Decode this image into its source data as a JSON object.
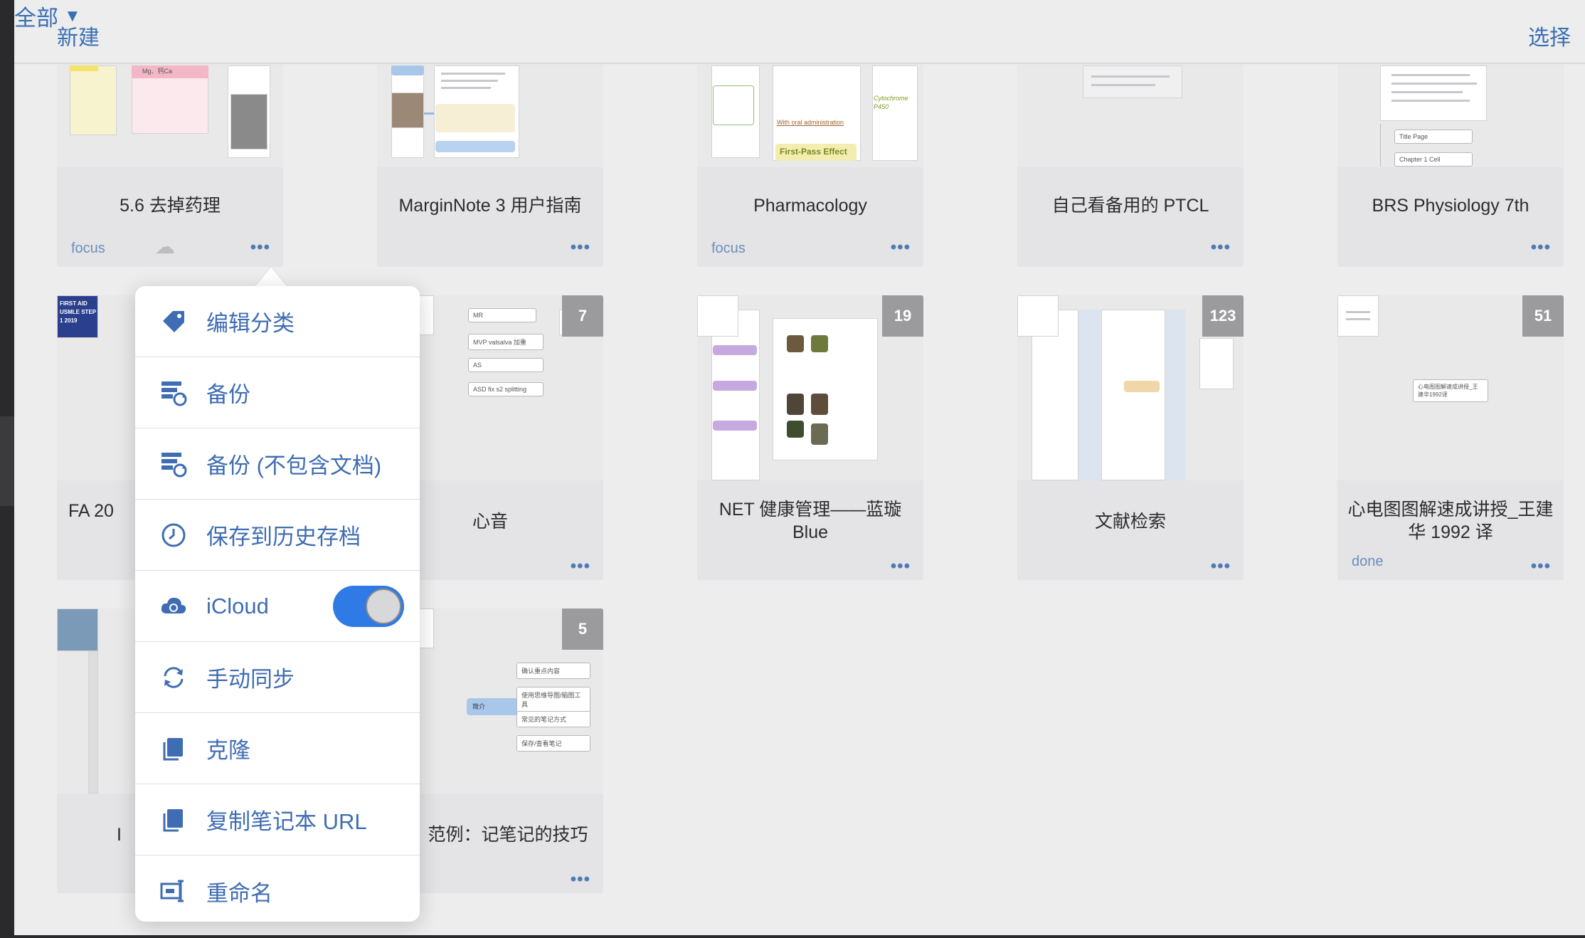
{
  "header": {
    "new_label": "新建",
    "filter_label": "全部",
    "filter_caret": "▼",
    "select_label": "选择"
  },
  "notebooks": [
    {
      "title": "5.6 去掉药理",
      "tag": "focus",
      "more": "•••",
      "cloud": true
    },
    {
      "title": "MarginNote 3 用户指南",
      "more": "•••"
    },
    {
      "title": "Pharmacology",
      "tag": "focus",
      "more": "•••"
    },
    {
      "title": "自己看备用的 PTCL",
      "more": "•••"
    },
    {
      "title": "BRS Physiology 7th",
      "more": "•••"
    },
    {
      "title": "FA 20",
      "more": "•••"
    },
    {
      "title": "心音",
      "badge": "7",
      "more": "•••"
    },
    {
      "title": "NET 健康管理——蓝璇 Blue",
      "badge": "19",
      "more": "•••"
    },
    {
      "title": "文献检索",
      "badge": "123",
      "more": "•••"
    },
    {
      "title": "心电图图解速成讲授_王建华 1992 译",
      "badge": "51",
      "tag": "done",
      "more": "•••"
    },
    {
      "title": "I",
      "more": "•••"
    },
    {
      "title": "范例：记笔记的技巧",
      "badge": "5",
      "more": "•••"
    }
  ],
  "thumb_text": {
    "first_pass": "First-Pass Effect",
    "oral_admin": "With oral administration",
    "cytochrome": "Cytochrome P450",
    "title_page": "Title Page",
    "chapter1": "Chapter 1 Cell",
    "mvp": "MVP valsalva 加重",
    "as": "AS",
    "asd": "ASD fix s2 splitting",
    "mr": "MR",
    "ecg_node": "心电图图解速成讲授_王建华1992译",
    "jianjie": "简介",
    "note1": "确认重点内容",
    "note2": "使用思维导图/脑图工具",
    "note3": "常见的笔记方式",
    "note4": "保存/查看笔记",
    "fa_cover": "FIRST AID USMLE STEP 1 2019",
    "mg_ca": "Mg、钙Ca"
  },
  "menu": {
    "items": [
      {
        "label": "编辑分类",
        "icon": "tag-icon"
      },
      {
        "label": "备份",
        "icon": "backup-icon"
      },
      {
        "label": "备份 (不包含文档)",
        "icon": "backup-no-docs-icon"
      },
      {
        "label": "保存到历史存档",
        "icon": "history-archive-icon"
      },
      {
        "label": "iCloud",
        "icon": "icloud-sync-icon",
        "toggle_on": true
      },
      {
        "label": "手动同步",
        "icon": "sync-icon"
      },
      {
        "label": "克隆",
        "icon": "clone-icon"
      },
      {
        "label": "复制笔记本 URL",
        "icon": "copy-url-icon"
      },
      {
        "label": "重命名",
        "icon": "rename-icon"
      }
    ]
  },
  "colors": {
    "accent": "#3a6fb3",
    "toggle_on": "#2f7ae5",
    "badge_bg": "#9b9b9d",
    "background": "#ededee"
  }
}
